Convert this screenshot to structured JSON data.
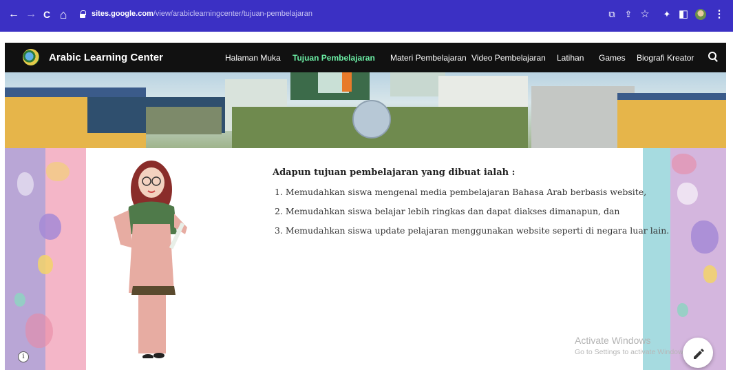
{
  "browser": {
    "url_domain": "sites.google.com",
    "url_path": "/view/arabiclearningcenter/tujuan-pembelajaran",
    "icons": [
      "back-arrow-icon",
      "forward-arrow-icon",
      "reload-icon",
      "home-icon",
      "lock-icon",
      "translate-icon",
      "share-icon",
      "star-icon",
      "extensions-icon",
      "sidepanel-icon",
      "profile-icon",
      "menu-icon"
    ],
    "glyphs": {
      "back": "←",
      "forward": "→",
      "reload": "C",
      "home": "⌂",
      "translate": "⧉",
      "share": "⇪",
      "star": "☆",
      "extensions": "✦",
      "sidepanel": "◧",
      "menu": "⋮"
    },
    "theme_color": "#3b30c4"
  },
  "site": {
    "title": "Arabic Learning Center",
    "nav": [
      {
        "label": "Halaman Muka",
        "active": false
      },
      {
        "label": "Tujuan Pembelajaran",
        "active": true
      },
      {
        "label": "Materi Pembelajaran",
        "active": false
      },
      {
        "label": "Video Pembelajaran",
        "active": false
      },
      {
        "label": "Latihan",
        "active": false
      },
      {
        "label": "Games",
        "active": false
      },
      {
        "label": "Biografi Kreator",
        "active": false
      }
    ],
    "active_color": "#6cf0a6"
  },
  "content": {
    "intro": "Adapun tujuan pembelajaran yang dibuat ialah :",
    "goals": [
      "1. Memudahkan siswa mengenal media pembelajaran Bahasa Arab berbasis website,",
      "2. Memudahkan siswa belajar lebih ringkas dan dapat diakses dimanapun, dan",
      "3. Memudahkan siswa update pelajaran menggunakan website seperti di negara luar lain."
    ]
  },
  "overlay": {
    "activate_title": "Activate Windows",
    "activate_sub": "Go to Settings to activate Windows.",
    "info_glyph": "i",
    "edit_icon": "pencil-icon"
  }
}
